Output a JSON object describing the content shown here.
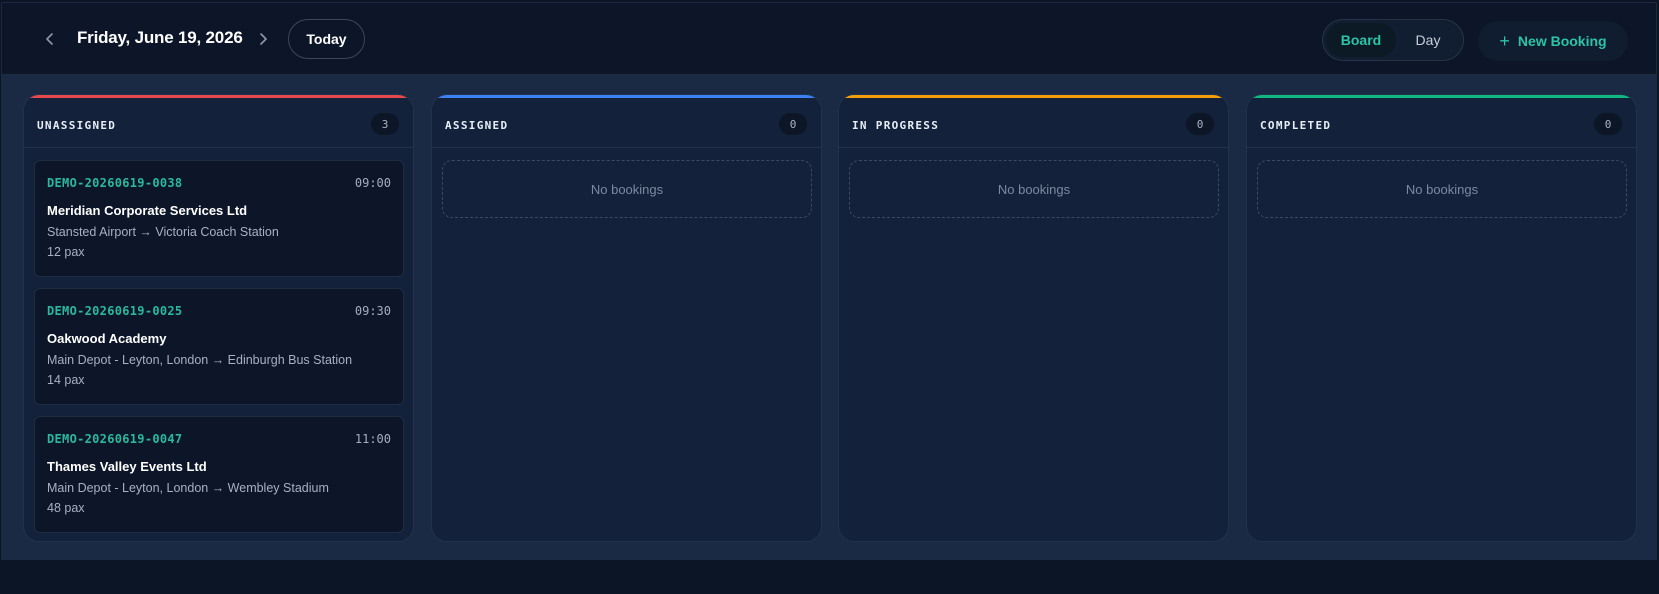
{
  "header": {
    "date": "Friday, June 19, 2026",
    "today_label": "Today",
    "prev_icon": "chevron-left-icon",
    "next_icon": "chevron-right-icon",
    "views": {
      "board": "Board",
      "day": "Day",
      "active": "Board"
    },
    "new_booking": {
      "icon": "plus-icon",
      "label": "New Booking"
    }
  },
  "colors": {
    "unassigned": "#e5484d",
    "assigned": "#3b82f6",
    "in_progress": "#f59e0b",
    "completed": "#10b981",
    "accent": "#2cc4a8"
  },
  "columns": [
    {
      "title": "UNASSIGNED",
      "count": "3",
      "bookings": [
        {
          "ref": "DEMO-20260619-0038",
          "time": "09:00",
          "client": "Meridian Corporate Services Ltd",
          "route": "Stansted Airport → Victoria Coach Station",
          "pax": "12 pax"
        },
        {
          "ref": "DEMO-20260619-0025",
          "time": "09:30",
          "client": "Oakwood Academy",
          "route": "Main Depot - Leyton, London → Edinburgh Bus Station",
          "pax": "14 pax"
        },
        {
          "ref": "DEMO-20260619-0047",
          "time": "11:00",
          "client": "Thames Valley Events Ltd",
          "route": "Main Depot - Leyton, London → Wembley Stadium",
          "pax": "48 pax"
        }
      ]
    },
    {
      "title": "ASSIGNED",
      "count": "0",
      "empty_text": "No bookings"
    },
    {
      "title": "IN PROGRESS",
      "count": "0",
      "empty_text": "No bookings"
    },
    {
      "title": "COMPLETED",
      "count": "0",
      "empty_text": "No bookings"
    }
  ]
}
